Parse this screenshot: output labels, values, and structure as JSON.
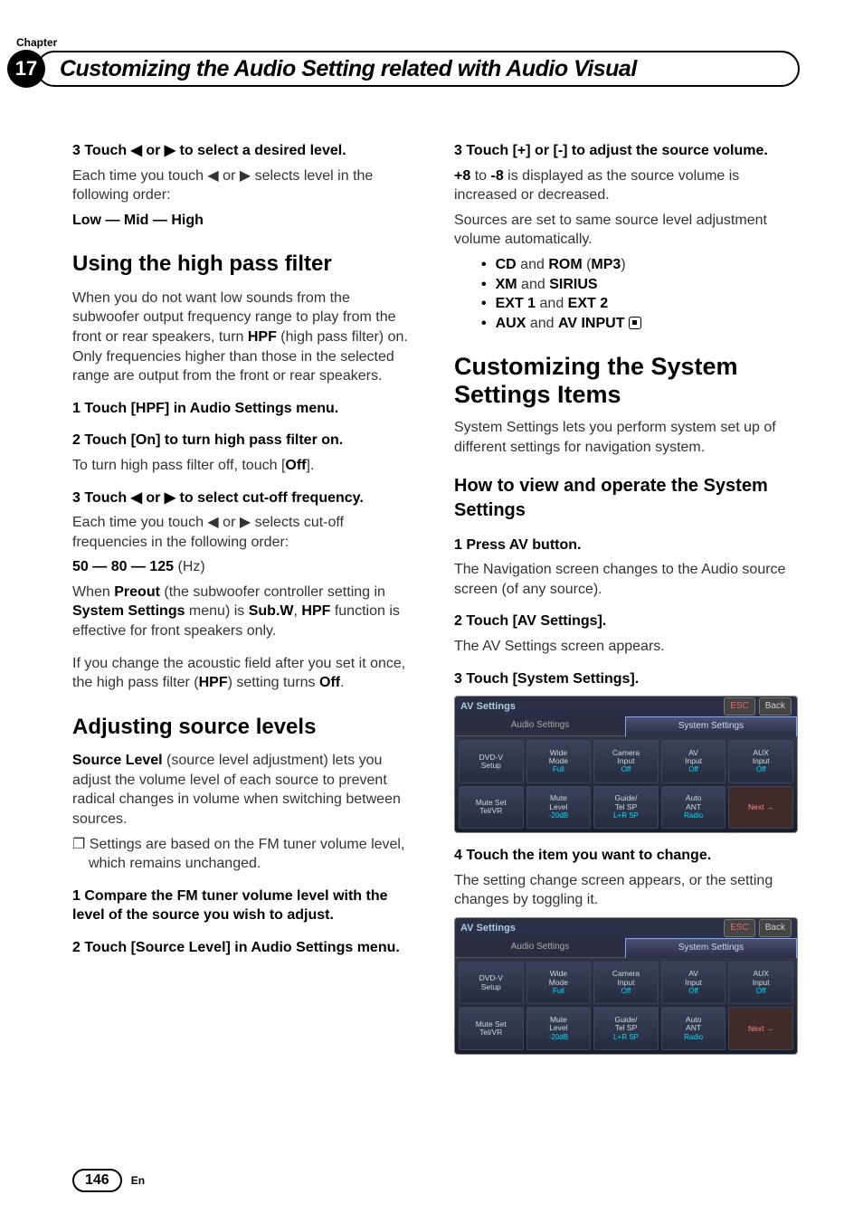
{
  "chapter_label": "Chapter",
  "chapter_number": "17",
  "title": "Customizing the Audio Setting related with Audio Visual",
  "left": {
    "step3a_head": "3   Touch ◀ or ▶ to select a desired level.",
    "step3a_body_1": "Each time you touch ◀ or ▶ selects level in the following order:",
    "step3a_levels": "Low — Mid — High",
    "hpf_heading": "Using the high pass filter",
    "hpf_intro_1": "When you do not want low sounds from the subwoofer output frequency range to play from the front or rear speakers, turn ",
    "hpf_intro_b1": "HPF",
    "hpf_intro_2": " (high pass filter) on. Only frequencies higher than those in the selected range are output from the front or rear speakers.",
    "hpf_step1": "1   Touch [HPF] in Audio Settings menu.",
    "hpf_step2": "2   Touch [On] to turn high pass filter on.",
    "hpf_step2_body_1": "To turn high pass filter off, touch [",
    "hpf_step2_body_b": "Off",
    "hpf_step2_body_2": "].",
    "hpf_step3": "3   Touch ◀ or ▶ to select cut-off frequency.",
    "hpf_step3_body": "Each time you touch ◀ or ▶ selects cut-off frequencies in the following order:",
    "hpf_freq": "50 — 80 — 125",
    "hpf_freq_unit": " (Hz)",
    "hpf_preout_1": "When ",
    "hpf_preout_b1": "Preout",
    "hpf_preout_2": " (the subwoofer controller setting in ",
    "hpf_preout_b2": "System Settings",
    "hpf_preout_3": " menu) is ",
    "hpf_preout_b3": "Sub.W",
    "hpf_preout_4": ", ",
    "hpf_preout_b4": "HPF",
    "hpf_preout_5": " function is effective for front speakers only.",
    "hpf_note_1": "If you change the acoustic field after you set it once, the high pass filter (",
    "hpf_note_b1": "HPF",
    "hpf_note_2": ") setting turns ",
    "hpf_note_b2": "Off",
    "hpf_note_3": ".",
    "src_heading": "Adjusting source levels",
    "src_intro_b": "Source Level",
    "src_intro_1": " (source level adjustment) lets you adjust the volume level of each source to prevent radical changes in volume when switching between sources.",
    "src_note": "Settings are based on the FM tuner volume level, which remains unchanged.",
    "src_step1": "1   Compare the FM tuner volume level with the level of the source you wish to adjust.",
    "src_step2": "2   Touch [Source Level] in Audio Settings menu."
  },
  "right": {
    "step3b_head": "3   Touch [+] or [-] to adjust the source volume.",
    "step3b_body_b1": "+8",
    "step3b_body_1": " to ",
    "step3b_body_b2": "-8",
    "step3b_body_2": " is displayed as the source volume is increased or decreased.",
    "step3b_body_3": "Sources are set to same source level adjustment volume automatically.",
    "bullets": {
      "b1a": "CD",
      "b1b": " and ",
      "b1c": "ROM",
      "b1d": " (",
      "b1e": "MP3",
      "b1f": ")",
      "b2a": "XM",
      "b2b": " and ",
      "b2c": "SIRIUS",
      "b3a": "EXT 1",
      "b3b": " and ",
      "b3c": "EXT 2",
      "b4a": "AUX",
      "b4b": " and ",
      "b4c": "AV INPUT"
    },
    "sys_heading": "Customizing the System Settings Items",
    "sys_intro": "System Settings lets you perform system set up of different settings for navigation system.",
    "howto_heading": "How to view and operate the System Settings",
    "howto_step1": "1   Press AV button.",
    "howto_step1_body": "The Navigation screen changes to the Audio source screen (of any source).",
    "howto_step2": "2   Touch [AV Settings].",
    "howto_step2_body": "The AV Settings screen appears.",
    "howto_step3": "3   Touch [System Settings].",
    "howto_step4": "4   Touch the item you want to change.",
    "howto_step4_body": "The setting change screen appears, or the setting changes by toggling it."
  },
  "screenshot": {
    "title": "AV Settings",
    "esc": "ESC",
    "back": "Back",
    "tab1": "Audio Settings",
    "tab2": "System Settings",
    "cells": [
      {
        "l1": "DVD-V",
        "l2": "Setup",
        "v": ""
      },
      {
        "l1": "Wide",
        "l2": "Mode",
        "v": "Full"
      },
      {
        "l1": "Camera",
        "l2": "Input",
        "v": "Off"
      },
      {
        "l1": "AV",
        "l2": "Input",
        "v": "Off"
      },
      {
        "l1": "AUX",
        "l2": "Input",
        "v": "Off"
      },
      {
        "l1": "Mute Set",
        "l2": "Tel/VR",
        "v": ""
      },
      {
        "l1": "Mute",
        "l2": "Level",
        "v": "-20dB"
      },
      {
        "l1": "Guide/",
        "l2": "Tel SP",
        "v": "L+R SP"
      },
      {
        "l1": "Auto",
        "l2": "ANT",
        "v": "Radio"
      },
      {
        "l1": "",
        "l2": "Next →",
        "v": ""
      }
    ]
  },
  "footer": {
    "page": "146",
    "lang": "En"
  }
}
